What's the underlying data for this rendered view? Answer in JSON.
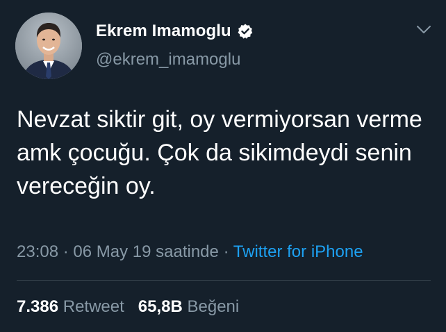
{
  "author": {
    "name": "Ekrem Imamoglu",
    "handle": "@ekrem_imamoglu",
    "verified": true,
    "avatar_icon": "profile-photo"
  },
  "tweet": {
    "text": "Nevzat siktir git, oy vermiyorsan verme amk çocuğu. Çok da sikimdeydi senin vereceğin oy.",
    "time": "23:08",
    "date": "06 May 19 saatinde",
    "separator": "·",
    "source": "Twitter for iPhone"
  },
  "stats": {
    "retweets_count": "7.386",
    "retweets_label": "Retweet",
    "likes_count": "65,8B",
    "likes_label": "Beğeni"
  },
  "colors": {
    "background": "#15202b",
    "secondary_text": "#8899a6",
    "link": "#1da1f2",
    "divider": "#38444d"
  },
  "icons": {
    "verified": "verified-badge-icon",
    "menu": "chevron-down-icon"
  }
}
